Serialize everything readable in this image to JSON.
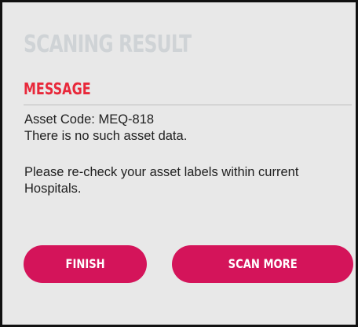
{
  "dialog": {
    "title": "SCANING RESULT",
    "message_heading": "MESSAGE",
    "asset_code_line": "Asset Code: MEQ-818",
    "no_data_line": "There is no such asset data.",
    "instruction": "Please re-check your asset labels within current Hospitals.",
    "finish_label": "FINISH",
    "scan_more_label": "SCAN MORE"
  },
  "colors": {
    "background": "#e8e8e8",
    "title": "#cfd3d6",
    "heading": "#e8283a",
    "button": "#d4145a",
    "button_text": "#ffffff",
    "text": "#1f1f1f"
  }
}
